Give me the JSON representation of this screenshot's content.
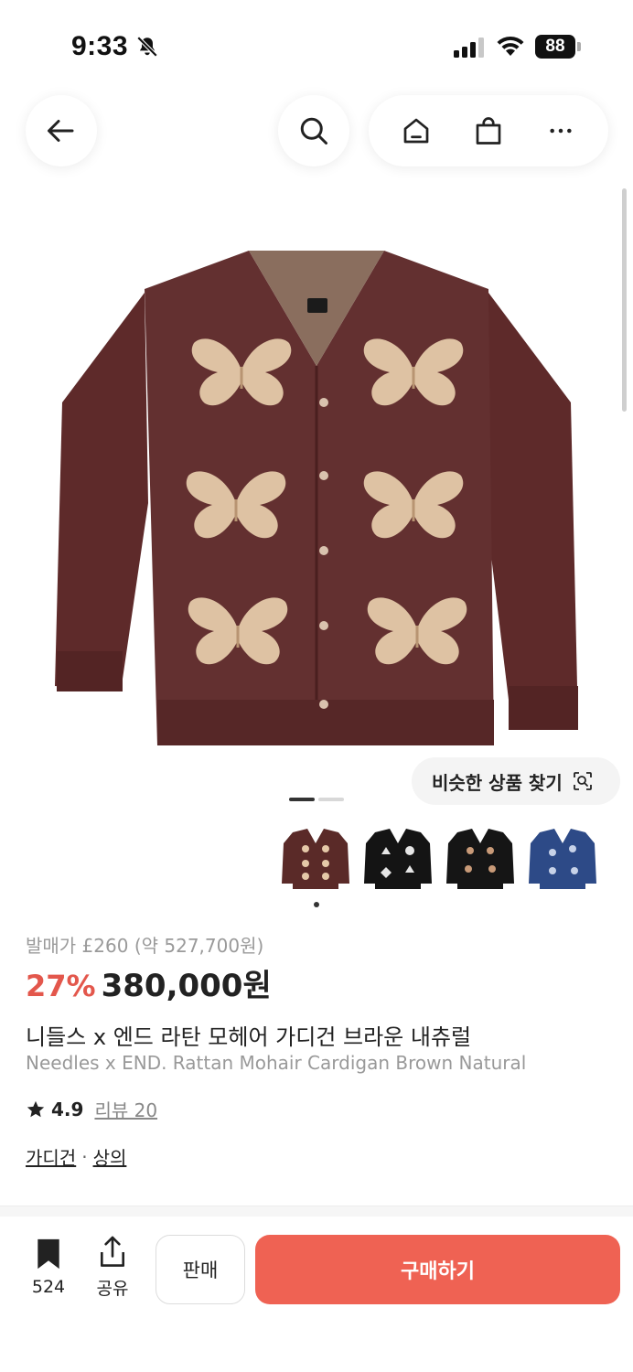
{
  "status_bar": {
    "time": "9:33",
    "battery": "88",
    "bell_icon": "bell-slash-icon",
    "signal_icon": "cellular-signal-icon",
    "wifi_icon": "wifi-icon"
  },
  "nav": {
    "back_icon": "arrow-left-icon",
    "search_icon": "search-icon",
    "home_icon": "home-icon",
    "bag_icon": "shopping-bag-icon",
    "more_icon": "more-horizontal-icon"
  },
  "image": {
    "similar_label": "비슷한 상품 찾기",
    "similar_icon": "image-search-icon",
    "page": 1,
    "page_total": 2
  },
  "thumbnails": [
    {
      "color": "#5a2a28",
      "accent": "#e5c9a8"
    },
    {
      "color": "#141414",
      "accent": "#e6e6e6"
    },
    {
      "color": "#151515",
      "accent": "#c89a78"
    },
    {
      "color": "#2d4a87",
      "accent": "#c7d2e8"
    }
  ],
  "product": {
    "release_price": "발매가 £260 (약 527,700원)",
    "discount": "27%",
    "price": "380,000원",
    "name_ko": "니들스 x 엔드 라탄 모헤어 가디건 브라운 내츄럴",
    "name_en": "Needles x END. Rattan Mohair Cardigan Brown Natural",
    "rating": "4.9",
    "review_label": "리뷰 20",
    "categories": [
      "가디건",
      "상의"
    ],
    "category_separator": "·"
  },
  "bottom": {
    "bookmark_count": "524",
    "share_label": "공유",
    "sell_label": "판매",
    "buy_label": "구매하기"
  },
  "colors": {
    "accent": "#ef6253",
    "discount": "#e3574c",
    "sweater": "#5e2a2a",
    "butterfly": "#e8cfae"
  }
}
